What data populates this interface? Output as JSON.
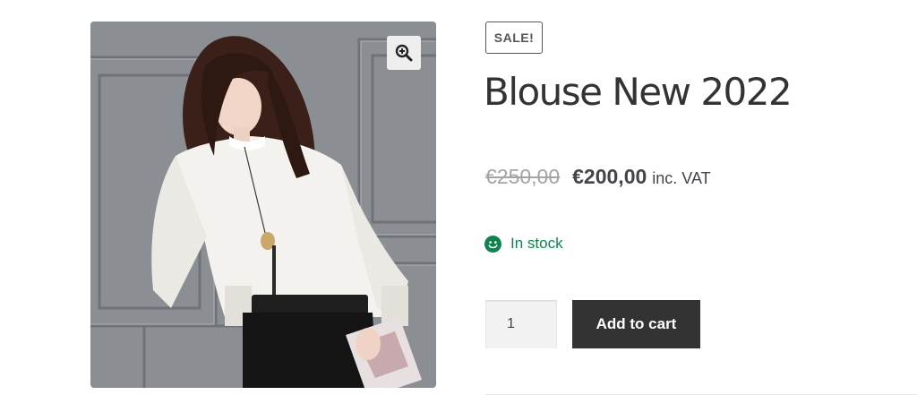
{
  "product": {
    "badge": "SALE!",
    "title": "Blouse New 2022",
    "price_old": "€250,00",
    "price_new": "€200,00",
    "price_suffix": "inc. VAT",
    "stock_status": "In stock",
    "quantity": "1",
    "add_to_cart_label": "Add to cart"
  },
  "icons": {
    "zoom": "magnifier-plus-icon",
    "stock": "smiley-icon"
  },
  "colors": {
    "button_bg": "#333333",
    "stock_green": "#0f834d",
    "old_price_grey": "#a4a4a4",
    "badge_border": "#555555"
  }
}
